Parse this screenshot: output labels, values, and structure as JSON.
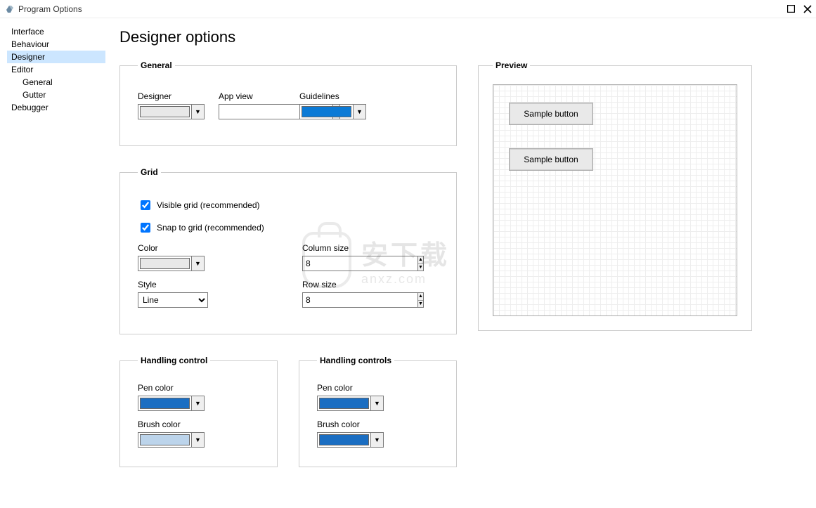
{
  "window": {
    "title": "Program Options"
  },
  "sidebar": {
    "items": [
      {
        "label": "Interface",
        "selected": false
      },
      {
        "label": "Behaviour",
        "selected": false
      },
      {
        "label": "Designer",
        "selected": true
      },
      {
        "label": "Editor",
        "selected": false
      },
      {
        "label": "General",
        "selected": false,
        "child": true
      },
      {
        "label": "Gutter",
        "selected": false,
        "child": true
      },
      {
        "label": "Debugger",
        "selected": false
      }
    ]
  },
  "page": {
    "title": "Designer options"
  },
  "general": {
    "legend": "General",
    "designer_label": "Designer",
    "designer_color": "#e8e8e8",
    "appview_label": "App view",
    "appview_value": "",
    "guidelines_label": "Guidelines",
    "guidelines_color": "#0b7ad6"
  },
  "grid": {
    "legend": "Grid",
    "visible_label": "Visible grid (recommended)",
    "visible_checked": true,
    "snap_label": "Snap to grid (recommended)",
    "snap_checked": true,
    "color_label": "Color",
    "color_value": "#e8e8e8",
    "column_label": "Column size",
    "column_value": "8",
    "style_label": "Style",
    "style_value": "Line",
    "row_label": "Row size",
    "row_value": "8"
  },
  "handling_control": {
    "legend": "Handling control",
    "pen_label": "Pen color",
    "pen_color": "#1b6ec2",
    "brush_label": "Brush color",
    "brush_color": "#bcd4eb"
  },
  "handling_controls": {
    "legend": "Handling controls",
    "pen_label": "Pen color",
    "pen_color": "#1b6ec2",
    "brush_label": "Brush color",
    "brush_color": "#1b6ec2"
  },
  "preview": {
    "legend": "Preview",
    "sample1": "Sample button",
    "sample2": "Sample button"
  },
  "watermark": {
    "cn": "安下载",
    "dom": "anxz.com"
  }
}
